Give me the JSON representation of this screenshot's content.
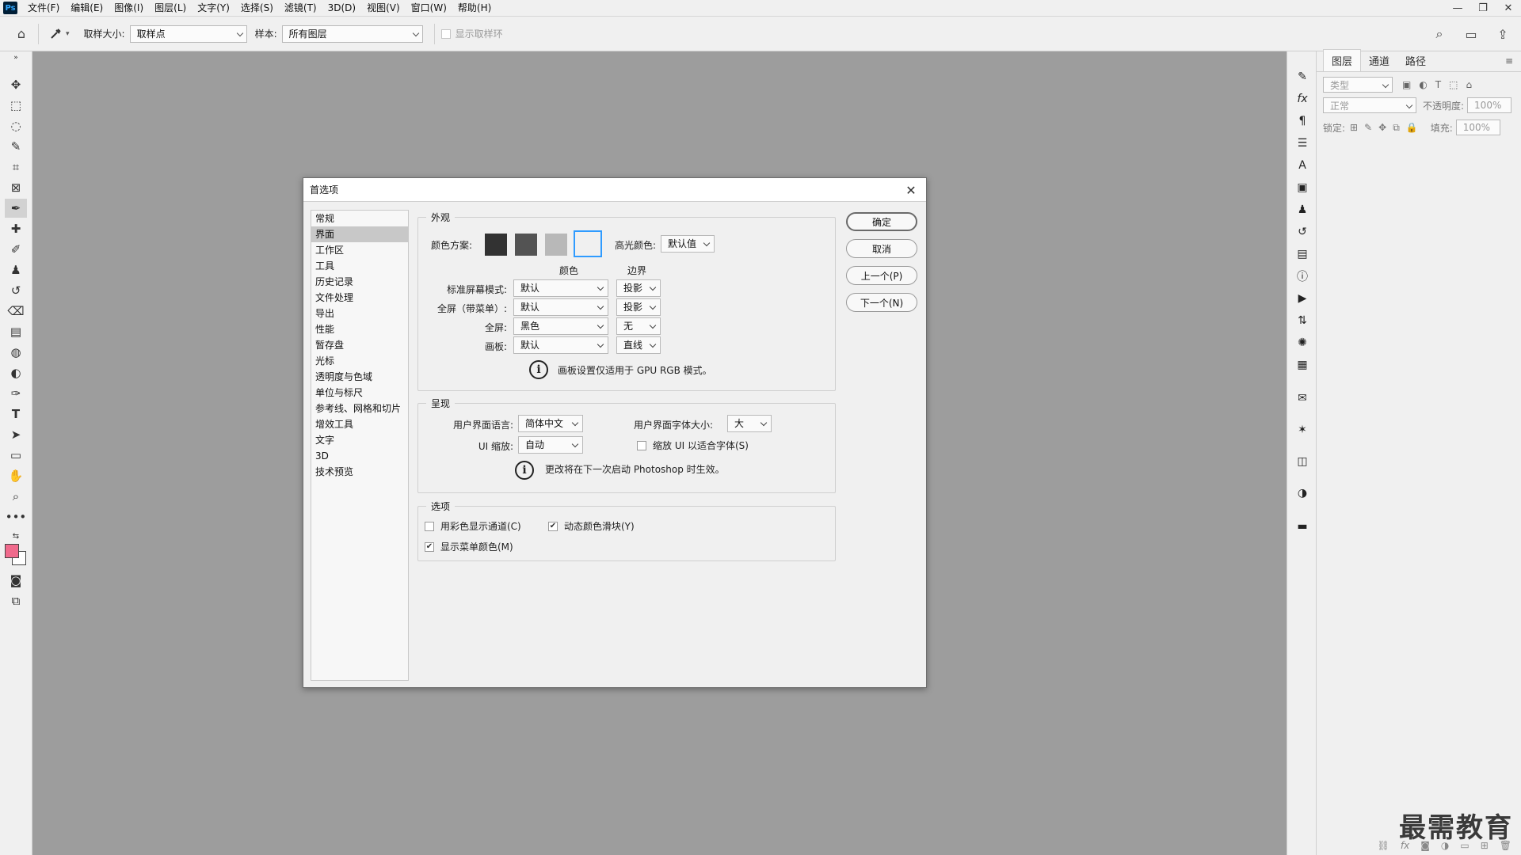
{
  "app": {
    "logo": "Ps"
  },
  "menu": [
    "文件(F)",
    "编辑(E)",
    "图像(I)",
    "图层(L)",
    "文字(Y)",
    "选择(S)",
    "滤镜(T)",
    "3D(D)",
    "视图(V)",
    "窗口(W)",
    "帮助(H)"
  ],
  "window_controls": {
    "minimize": "—",
    "restore": "❐",
    "close": "✕"
  },
  "options": {
    "sample_size_label": "取样大小:",
    "sample_size_value": "取样点",
    "sample_label": "样本:",
    "sample_value": "所有图层",
    "show_ring_label": "显示取样环"
  },
  "layers_panel": {
    "tabs": [
      "图层",
      "通道",
      "路径"
    ],
    "filter_placeholder": "类型",
    "blend_mode": "正常",
    "opacity_label": "不透明度:",
    "opacity_value": "100%",
    "lock_label": "锁定:",
    "fill_label": "填充:",
    "fill_value": "100%"
  },
  "dialog": {
    "title": "首选项",
    "close": "✕",
    "categories": [
      "常规",
      "界面",
      "工作区",
      "工具",
      "历史记录",
      "文件处理",
      "导出",
      "性能",
      "暂存盘",
      "光标",
      "透明度与色域",
      "单位与标尺",
      "参考线、网格和切片",
      "增效工具",
      "文字",
      "3D",
      "技术预览"
    ],
    "active_category": "界面",
    "appearance": {
      "title": "外观",
      "color_scheme_label": "颜色方案:",
      "swatch_colors": [
        "#323232",
        "#535353",
        "#b8b8b8",
        "#f0f0f0"
      ],
      "highlight_label": "高光颜色:",
      "highlight_value": "默认值",
      "col_color": "颜色",
      "col_border": "边界",
      "rows": [
        {
          "label": "标准屏幕模式:",
          "color": "默认",
          "border": "投影"
        },
        {
          "label": "全屏（带菜单）:",
          "color": "默认",
          "border": "投影"
        },
        {
          "label": "全屏:",
          "color": "黑色",
          "border": "无"
        },
        {
          "label": "画板:",
          "color": "默认",
          "border": "直线"
        }
      ],
      "note": "画板设置仅适用于 GPU RGB 模式。"
    },
    "presentation": {
      "title": "呈现",
      "language_label": "用户界面语言:",
      "language_value": "简体中文",
      "font_size_label": "用户界面字体大小:",
      "font_size_value": "大",
      "scale_label": "UI 缩放:",
      "scale_value": "自动",
      "scale_to_font_label": "缩放 UI 以适合字体(S)",
      "note": "更改将在下一次启动 Photoshop 时生效。"
    },
    "options": {
      "title": "选项",
      "color_channels_label": "用彩色显示通道(C)",
      "dynamic_sliders_label": "动态颜色滑块(Y)",
      "menu_colors_label": "显示菜单颜色(M)"
    },
    "buttons": {
      "ok": "确定",
      "cancel": "取消",
      "prev": "上一个(P)",
      "next": "下一个(N)"
    }
  },
  "watermark": "最需教育"
}
